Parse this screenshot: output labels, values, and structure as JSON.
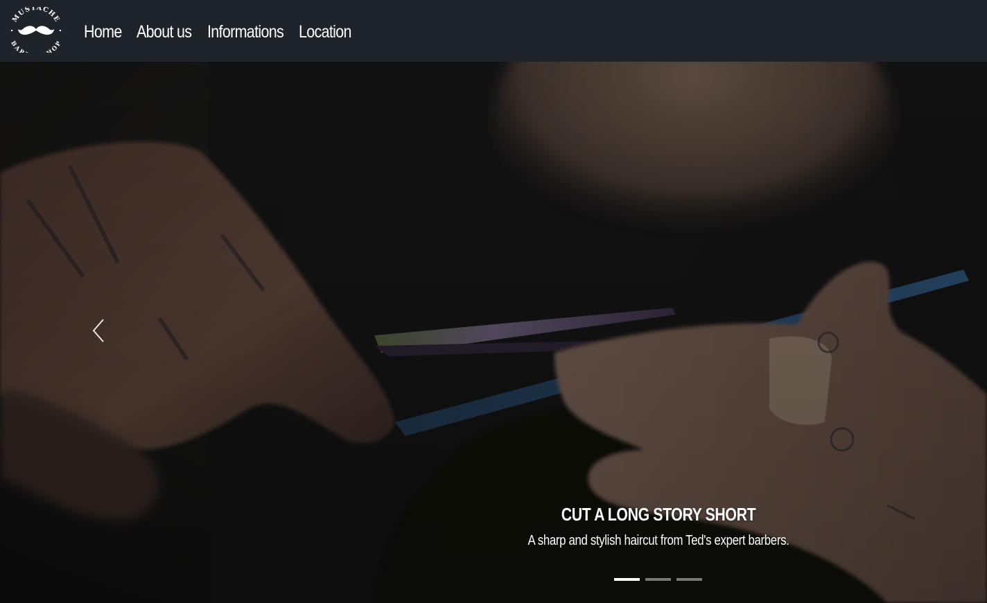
{
  "brand": {
    "top_text": "MUSTACHE",
    "bottom_text": "BARBERSHOP"
  },
  "nav": {
    "items": [
      {
        "label": "Home"
      },
      {
        "label": "About us"
      },
      {
        "label": "Informations"
      },
      {
        "label": "Location"
      }
    ]
  },
  "carousel": {
    "caption_title": "CUT A LONG STORY SHORT",
    "caption_text": "A sharp and stylish haircut from Ted's expert barbers.",
    "slide_count": 3,
    "active_slide": 1,
    "prev_icon": "chevron-left-icon"
  },
  "colors": {
    "navbar_bg": "#1f232a",
    "text": "#ffffff",
    "indicator_active": "#ffffff",
    "indicator_inactive": "#8a8a8a"
  }
}
